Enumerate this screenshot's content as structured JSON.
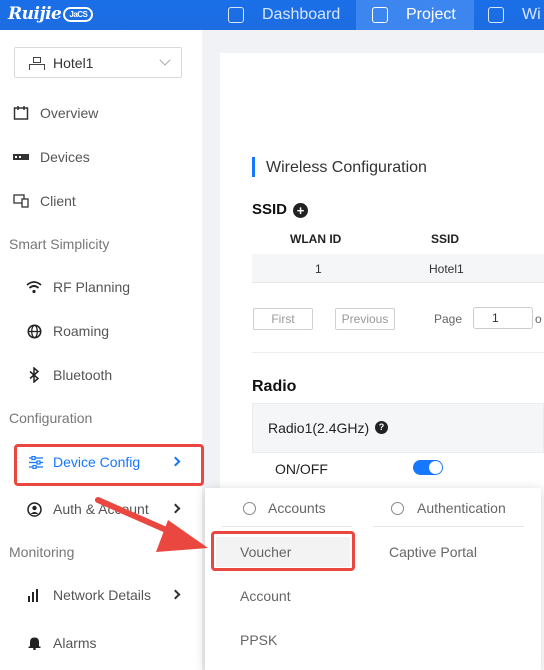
{
  "topbar": {
    "logo": "Ruijie",
    "logo_badge": "JaCS",
    "nav": [
      {
        "label": "Dashboard",
        "icon": "dashboard-icon"
      },
      {
        "label": "Project",
        "icon": "project-cube-icon",
        "active": true
      },
      {
        "label": "Wi",
        "icon": "wireless-icon"
      }
    ]
  },
  "sidebar": {
    "project_select": "Hotel1",
    "items": [
      {
        "label": "Overview",
        "icon": "overview-icon"
      },
      {
        "label": "Devices",
        "icon": "devices-icon"
      },
      {
        "label": "Client",
        "icon": "client-icon"
      }
    ],
    "section_smart": "Smart Simplicity",
    "smart_items": [
      {
        "label": "RF Planning",
        "icon": "wifi-icon"
      },
      {
        "label": "Roaming",
        "icon": "globe-icon"
      },
      {
        "label": "Bluetooth",
        "icon": "bluetooth-icon"
      }
    ],
    "section_config": "Configuration",
    "config_items": [
      {
        "label": "Device Config",
        "icon": "sliders-icon",
        "active": true
      },
      {
        "label": "Auth & Account",
        "icon": "user-icon"
      }
    ],
    "section_monitor": "Monitoring",
    "monitor_items": [
      {
        "label": "Network Details",
        "icon": "bar-chart-icon"
      },
      {
        "label": "Alarms",
        "icon": "bell-icon"
      }
    ]
  },
  "main": {
    "section_title": "Wireless Configuration",
    "ssid_title": "SSID",
    "table": {
      "headers": [
        "WLAN ID",
        "SSID"
      ],
      "rows": [
        [
          "1",
          "Hotel1"
        ]
      ]
    },
    "pagination": {
      "first": "First",
      "previous": "Previous",
      "page_label": "Page",
      "page_value": "1",
      "of_label": "o"
    },
    "radio_title": "Radio",
    "radio_name": "Radio1(2.4GHz)",
    "onoff_label": "ON/OFF",
    "onoff_value": true
  },
  "dropdown": {
    "group1": "Accounts",
    "group2": "Authentication",
    "accounts_items": [
      "Voucher",
      "Account",
      "PPSK"
    ],
    "auth_items": [
      "Captive Portal"
    ]
  },
  "colors": {
    "brand": "#1d6ce0",
    "accent": "#1677ff",
    "highlight": "#e9473f"
  }
}
